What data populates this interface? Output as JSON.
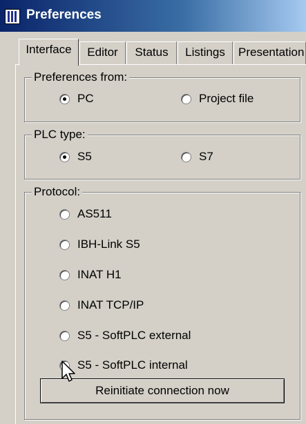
{
  "window": {
    "title": "Preferences",
    "icon": "app-window-icon"
  },
  "tabs": [
    {
      "label": "Interface",
      "active": true
    },
    {
      "label": "Editor",
      "active": false
    },
    {
      "label": "Status",
      "active": false
    },
    {
      "label": "Listings",
      "active": false
    },
    {
      "label": "Presentation",
      "active": false
    }
  ],
  "groups": {
    "preferences_from": {
      "legend": "Preferences from:",
      "options": [
        {
          "label": "PC",
          "selected": true
        },
        {
          "label": "Project file",
          "selected": false
        }
      ]
    },
    "plc_type": {
      "legend": "PLC type:",
      "options": [
        {
          "label": "S5",
          "selected": true
        },
        {
          "label": "S7",
          "selected": false
        }
      ]
    },
    "protocol": {
      "legend": "Protocol:",
      "options": [
        {
          "label": "AS511",
          "selected": false
        },
        {
          "label": "IBH-Link S5",
          "selected": false
        },
        {
          "label": "INAT H1",
          "selected": false
        },
        {
          "label": "INAT TCP/IP",
          "selected": false
        },
        {
          "label": "S5 - SoftPLC external",
          "selected": false
        },
        {
          "label": "S5 - SoftPLC internal",
          "selected": true
        }
      ]
    }
  },
  "buttons": {
    "reinitiate_label": "Reinitiate connection now"
  },
  "colors": {
    "titlebar_start": "#0a246a",
    "titlebar_end": "#a6caf0",
    "face": "#d4d0c8"
  }
}
